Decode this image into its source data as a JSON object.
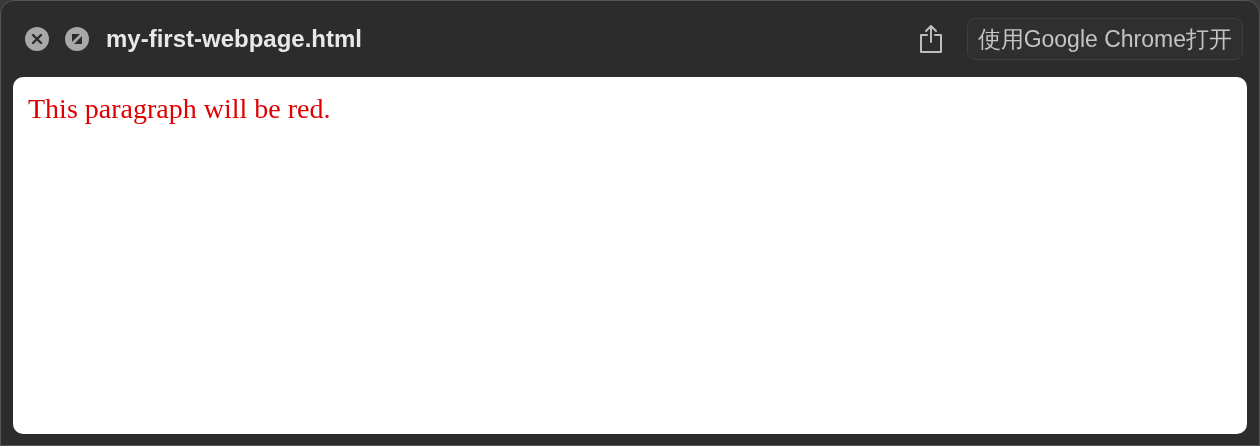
{
  "window": {
    "title": "my-first-webpage.html"
  },
  "toolbar": {
    "open_button": "使用Google Chrome打开"
  },
  "page": {
    "paragraph": "This paragraph will be red."
  }
}
